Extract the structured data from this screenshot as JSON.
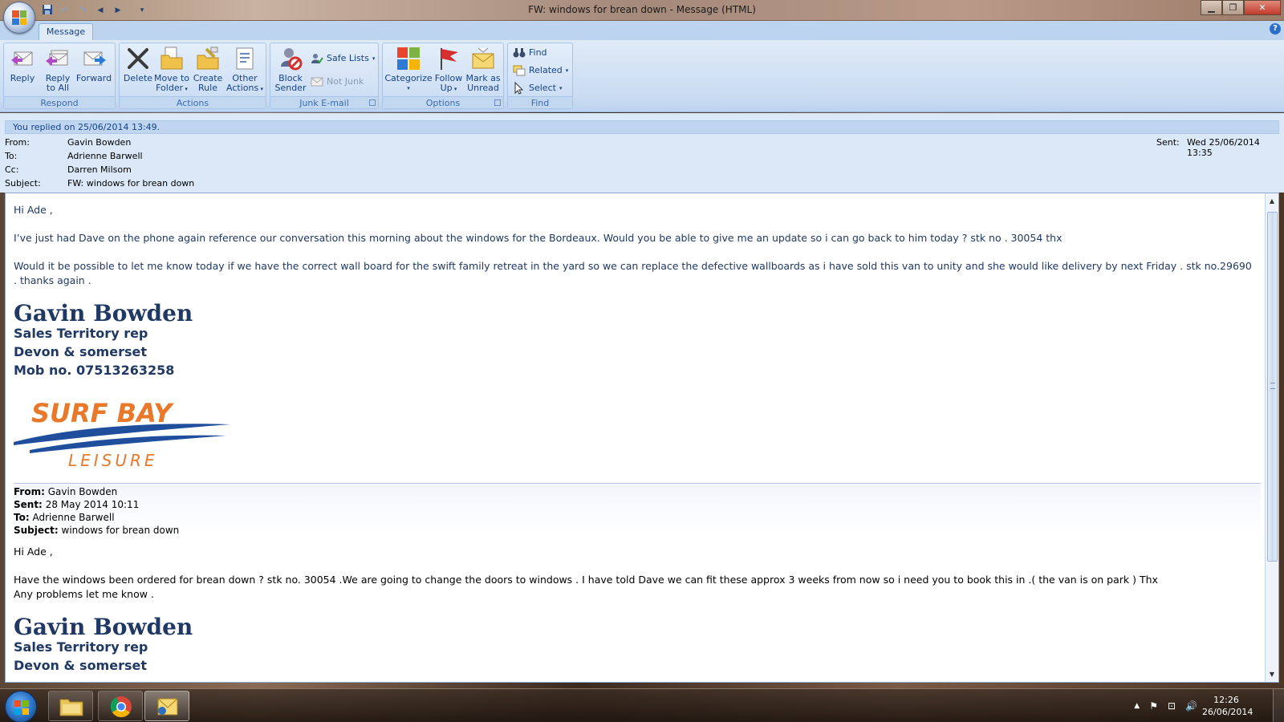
{
  "window": {
    "title": "FW: windows for brean down  - Message (HTML)",
    "minimize": "▁",
    "restore": "❐",
    "close": "✕"
  },
  "qat": {
    "save": "💾",
    "undo": "↶",
    "redo": "↷",
    "prev": "◀",
    "next": "▶",
    "customize": "▾"
  },
  "ribbon": {
    "tab": "Message",
    "help": "?",
    "groups": {
      "respond": {
        "label": "Respond",
        "reply": "Reply",
        "reply_all_1": "Reply",
        "reply_all_2": "to All",
        "forward": "Forward"
      },
      "actions": {
        "label": "Actions",
        "delete": "Delete",
        "move_1": "Move to",
        "move_2": "Folder",
        "rule_1": "Create",
        "rule_2": "Rule",
        "other_1": "Other",
        "other_2": "Actions"
      },
      "junk": {
        "label": "Junk E-mail",
        "block_1": "Block",
        "block_2": "Sender",
        "safe_lists": "Safe Lists",
        "not_junk": "Not Junk"
      },
      "options": {
        "label": "Options",
        "categorize": "Categorize",
        "follow_1": "Follow",
        "follow_2": "Up",
        "mark_1": "Mark as",
        "mark_2": "Unread"
      },
      "find": {
        "label": "Find",
        "find": "Find",
        "related": "Related",
        "select": "Select"
      }
    }
  },
  "header": {
    "replied": "You replied on 25/06/2014 13:49.",
    "from_label": "From:",
    "from": "Gavin Bowden",
    "to_label": "To:",
    "to": "Adrienne Barwell",
    "cc_label": "Cc:",
    "cc": "Darren Milsom",
    "subject_label": "Subject:",
    "subject": "FW: windows for brean down",
    "sent_label": "Sent:",
    "sent": "Wed 25/06/2014 13:35"
  },
  "body": {
    "greeting": "Hi Ade ,",
    "para1": "I’ve just had Dave on the phone again reference our conversation this morning about the windows for the Bordeaux. Would you be able to give me an update so i can go back to him today ? stk no . 30054  thx",
    "para2": "Would it be possible to let me know today  if we have the correct wall board for the swift family retreat in the yard so we can replace the defective wallboards as i have sold this van to unity and she would like delivery by next Friday . stk no.29690 . thanks again .",
    "sig_name": "Gavin Bowden",
    "sig_title": "Sales Territory rep",
    "sig_area": "Devon & somerset",
    "sig_mob": "Mob no. 07513263258",
    "logo_top": "SURF BAY",
    "logo_bottom": "LEISURE",
    "fw_from_label": "From:",
    "fw_from": "Gavin Bowden",
    "fw_sent_label": "Sent:",
    "fw_sent": "28 May 2014 10:11",
    "fw_to_label": "To:",
    "fw_to": "Adrienne Barwell",
    "fw_subject_label": "Subject:",
    "fw_subject": "windows for brean down",
    "fw_greeting": "Hi Ade ,",
    "fw_para1": "Have the windows been ordered for brean down ? stk no. 30054 .We are going to change the doors to windows . I have told Dave we can fit these approx 3 weeks from now so i need you to book this in .( the van is on park ) Thx",
    "fw_para2": "Any problems let me know .",
    "fw_sig_name": "Gavin Bowden",
    "fw_sig_title": "Sales Territory rep",
    "fw_sig_area": "Devon & somerset"
  },
  "taskbar": {
    "time": "12:26",
    "date": "26/06/2014",
    "tray_arrow": "▲",
    "tray_flag": "⚑",
    "tray_network": "⊡",
    "tray_volume": "🔊"
  },
  "colors": {
    "ribbon": "#dfeaf7",
    "body_text": "#1f3864",
    "logo_orange": "#e8782a",
    "logo_blue": "#1f4e9c"
  }
}
